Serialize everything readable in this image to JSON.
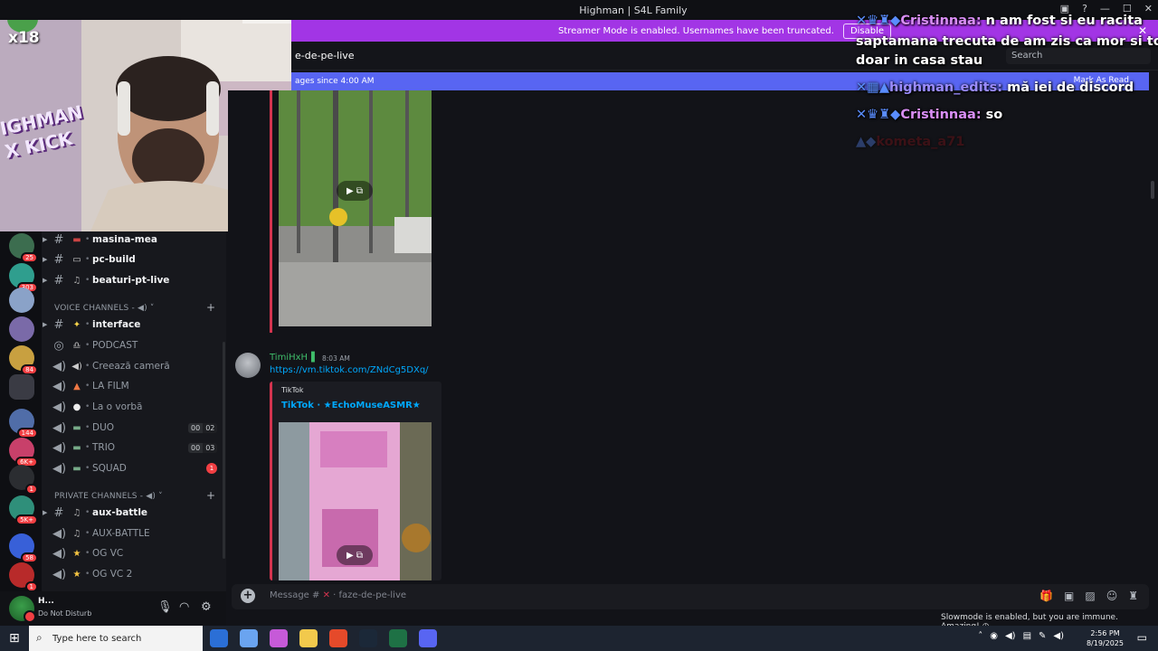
{
  "window": {
    "title": "Highman | S4L Family"
  },
  "streamer_banner": {
    "text": "Streamer Mode is enabled. Usernames have been truncated.",
    "button": "Disable"
  },
  "channel": {
    "name": "e-de-pe-live",
    "search_placeholder": "Search"
  },
  "new_messages": {
    "text": "ages since 4:00 AM",
    "mark_read": "Mark As Read"
  },
  "overlay": {
    "badge_text": "x18",
    "logo_text": "IGHMAN X KICK"
  },
  "servers": [
    {
      "badge": "25"
    },
    {
      "badge": "303"
    },
    {
      "badge": ""
    },
    {
      "badge": ""
    },
    {
      "badge": "84"
    },
    {
      "badge": ""
    },
    {
      "badge": "144"
    },
    {
      "badge": "6K+"
    },
    {
      "badge": "1"
    },
    {
      "badge": "5K+"
    },
    {
      "badge": "58"
    },
    {
      "badge": "1"
    }
  ],
  "sidebar": {
    "text_channels": [
      {
        "name": "masina-mea"
      },
      {
        "name": "pc-build"
      },
      {
        "name": "beaturi-pt-live"
      }
    ],
    "voice_category": "VOICE CHANNELS -",
    "voice_channels": [
      {
        "name": "interface"
      },
      {
        "name": "PODCAST"
      },
      {
        "name": "Creează cameră"
      },
      {
        "name": "LA FILM"
      },
      {
        "name": "La o vorbă"
      },
      {
        "name": "DUO",
        "count": [
          "00",
          "02"
        ]
      },
      {
        "name": "TRIO",
        "count": [
          "00",
          "03"
        ]
      },
      {
        "name": "SQUAD",
        "unread": "1"
      }
    ],
    "private_category": "PRIVATE CHANNELS -",
    "private_channels": [
      {
        "name": "aux-battle"
      },
      {
        "name": "AUX-BATTLE"
      },
      {
        "name": "OG VC"
      },
      {
        "name": "OG VC 2"
      }
    ]
  },
  "user": {
    "name": "H...",
    "status": "Do Not Disturb"
  },
  "message": {
    "author": "TimiHxH",
    "time": "8:03 AM",
    "link": "https://vm.tiktok.com/ZNdCg5DXq/",
    "embed_provider": "TikTok",
    "embed_title": "TikTok · ★EchoMuseASMR★"
  },
  "composer": {
    "placeholder": "Message #",
    "channel": "faze-de-pe-live"
  },
  "slowmode": "Slowmode is enabled, but you are immune. Amazing!",
  "taskbar": {
    "search_placeholder": "Type here to search",
    "time": "2:56 PM",
    "date": "8/19/2025"
  },
  "chat": [
    {
      "user": "Cristinnaa:",
      "text": " n am fost si eu racita"
    },
    {
      "user": "",
      "text": "saptamana trecuta de am zis ca mor si tot"
    },
    {
      "user": "",
      "text": "doar in casa stau"
    },
    {
      "user": "highman_edits:",
      "text": " mă iei de discord"
    },
    {
      "user": "Cristinnaa:",
      "text": " so"
    },
    {
      "user": "kometa_a71",
      "text": ""
    }
  ]
}
